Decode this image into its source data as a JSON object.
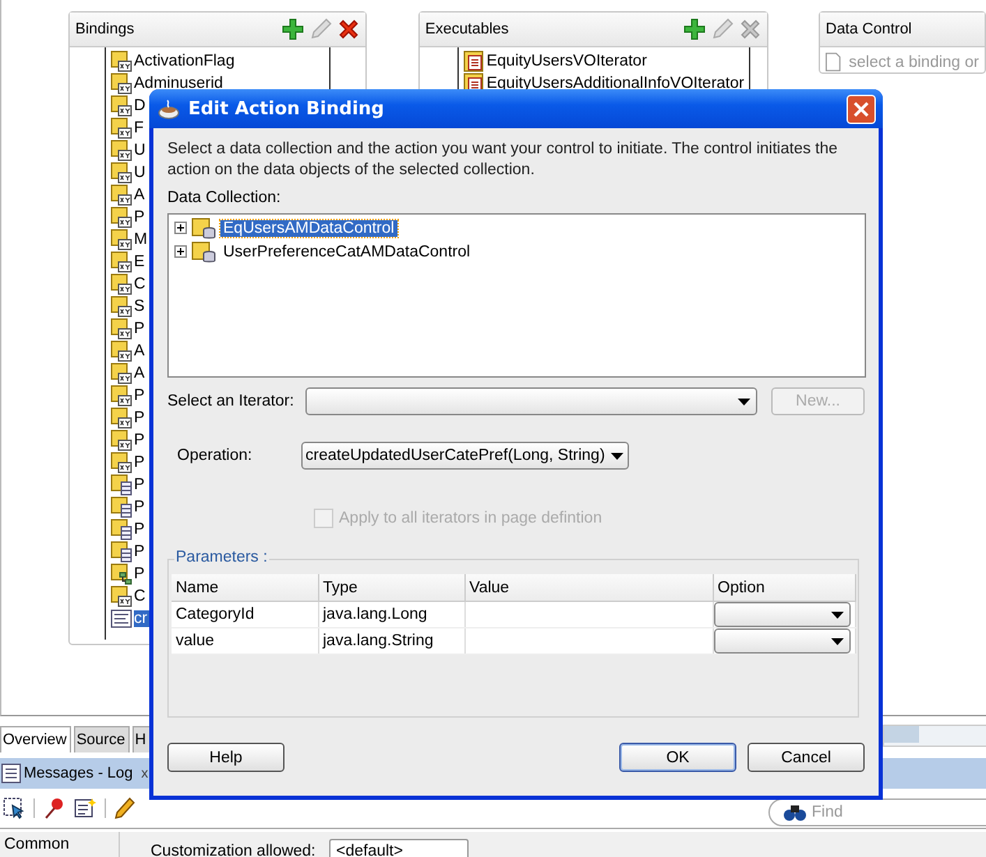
{
  "ide": {
    "bindings": {
      "title": "Bindings",
      "actions": [
        {
          "kind": "add",
          "disabled": false
        },
        {
          "kind": "edit",
          "disabled": true
        },
        {
          "kind": "delete",
          "disabled": false
        }
      ],
      "items": [
        {
          "label": "ActivationFlag",
          "kind": "attribute",
          "selected": false
        },
        {
          "label": "Adminuserid",
          "kind": "attribute",
          "selected": false
        },
        {
          "label": "D",
          "kind": "attribute",
          "selected": false
        },
        {
          "label": "F",
          "kind": "attribute",
          "selected": false
        },
        {
          "label": "U",
          "kind": "attribute",
          "selected": false
        },
        {
          "label": "U",
          "kind": "attribute",
          "selected": false
        },
        {
          "label": "A",
          "kind": "attribute",
          "selected": false
        },
        {
          "label": "P",
          "kind": "attribute",
          "selected": false
        },
        {
          "label": "M",
          "kind": "attribute",
          "selected": false
        },
        {
          "label": "E",
          "kind": "attribute",
          "selected": false
        },
        {
          "label": "C",
          "kind": "attribute",
          "selected": false
        },
        {
          "label": "S",
          "kind": "attribute",
          "selected": false
        },
        {
          "label": "P",
          "kind": "attribute",
          "selected": false
        },
        {
          "label": "A",
          "kind": "attribute",
          "selected": false
        },
        {
          "label": "A",
          "kind": "attribute",
          "selected": false
        },
        {
          "label": "P",
          "kind": "attribute",
          "selected": false
        },
        {
          "label": "P",
          "kind": "attribute",
          "selected": false
        },
        {
          "label": "P",
          "kind": "attribute",
          "selected": false
        },
        {
          "label": "P",
          "kind": "attribute",
          "selected": false
        },
        {
          "label": "P",
          "kind": "table",
          "selected": false
        },
        {
          "label": "P",
          "kind": "table",
          "selected": false
        },
        {
          "label": "P",
          "kind": "table",
          "selected": false
        },
        {
          "label": "P",
          "kind": "table",
          "selected": false
        },
        {
          "label": "P",
          "kind": "tree",
          "selected": false
        },
        {
          "label": "C",
          "kind": "attribute",
          "selected": false
        },
        {
          "label": "cr",
          "kind": "method",
          "selected": true
        }
      ]
    },
    "executables": {
      "title": "Executables",
      "actions": [
        {
          "kind": "add",
          "disabled": false
        },
        {
          "kind": "edit",
          "disabled": true
        },
        {
          "kind": "delete",
          "disabled": true
        }
      ],
      "items": [
        {
          "label": "EquityUsersVOIterator"
        },
        {
          "label": "EquityUsersAdditionalInfoVOIterator"
        }
      ]
    },
    "data_control": {
      "title": "Data Control",
      "placeholder": "select a binding or"
    },
    "editor_tabs": [
      {
        "label": "Overview",
        "selected": true
      },
      {
        "label": "Source",
        "selected": false
      },
      {
        "label": "H",
        "selected": false
      }
    ],
    "log_panel": {
      "title": "Messages - Log",
      "close": "x"
    },
    "find": {
      "placeholder": "Find"
    },
    "properties": {
      "category": "Common",
      "label": "Customization allowed:",
      "value": "<default>"
    }
  },
  "dialog": {
    "title": "Edit Action Binding",
    "description": "Select a data collection and the action you want your control to initiate. The control initiates the action on the data objects of the selected collection.",
    "collection_label": "Data Collection:",
    "collections": [
      {
        "label": "EqUsersAMDataControl",
        "expanded": false,
        "selected": true
      },
      {
        "label": "UserPreferenceCatAMDataControl",
        "expanded": false,
        "selected": false
      }
    ],
    "iterator": {
      "label": "Select an Iterator:",
      "new_button": {
        "label": "New...",
        "disabled": true
      }
    },
    "operation": {
      "label": "Operation:",
      "value": "createUpdatedUserCatePref(Long, String)"
    },
    "apply_all": {
      "label": "Apply to all iterators in page defintion",
      "checked": false,
      "disabled": true
    },
    "parameters": {
      "title": "Parameters :",
      "columns": [
        "Name",
        "Type",
        "Value",
        "Option"
      ],
      "rows": [
        {
          "name": "CategoryId",
          "type": "java.lang.Long"
        },
        {
          "name": "value",
          "type": "java.lang.String"
        }
      ]
    },
    "buttons": [
      {
        "label": "Help",
        "default": false
      },
      {
        "label": "OK",
        "default": true
      },
      {
        "label": "Cancel",
        "default": false
      }
    ]
  }
}
